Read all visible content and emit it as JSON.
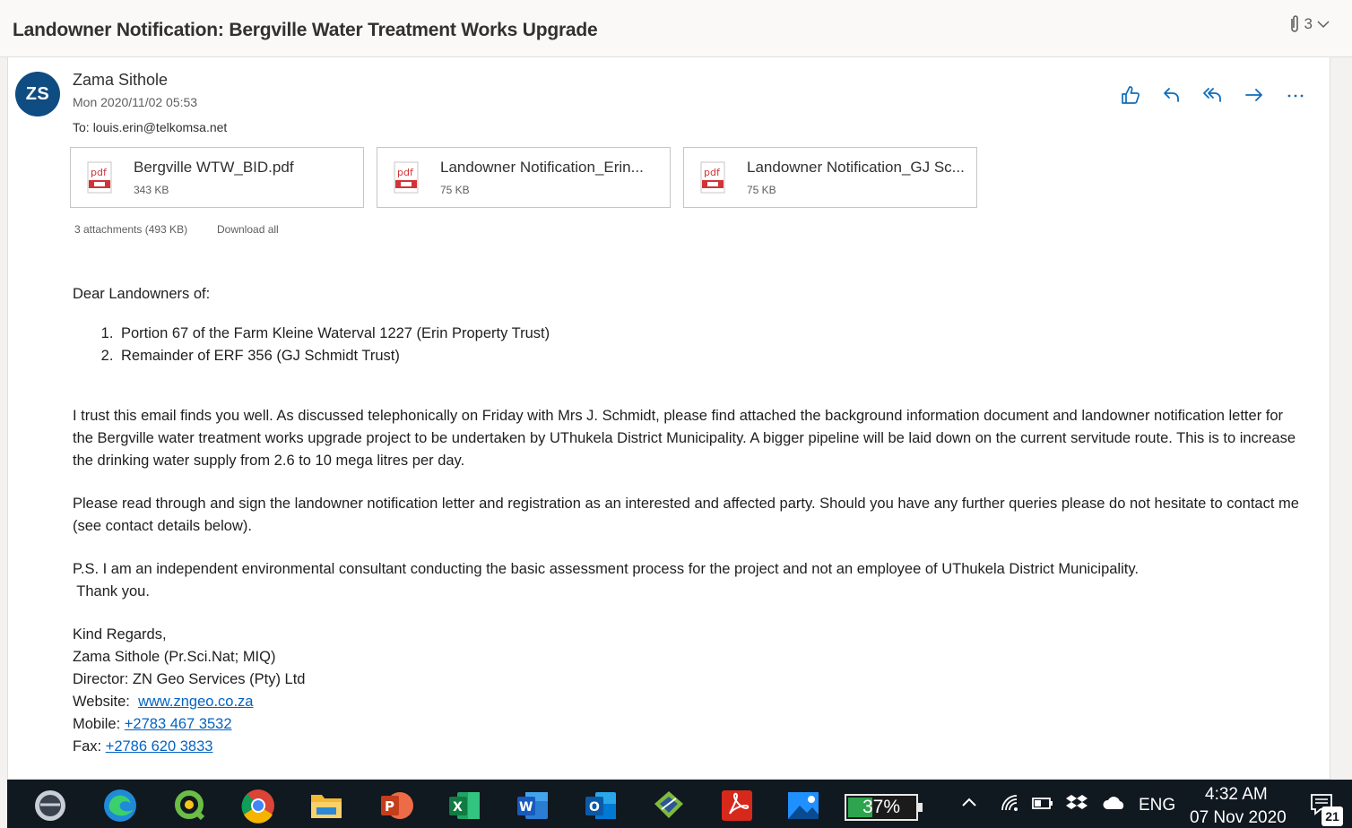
{
  "subject": "Landowner Notification: Bergville Water Treatment Works Upgrade",
  "message_count": "3",
  "sender": {
    "initials": "ZS",
    "name": "Zama Sithole",
    "date": "Mon 2020/11/02 05:53",
    "to_label": "To:",
    "to": "louis.erin@telkomsa.net"
  },
  "attachments": [
    {
      "name": "Bergville WTW_BID.pdf",
      "size": "343 KB",
      "type_label": "pdf"
    },
    {
      "name": "Landowner Notification_Erin...",
      "size": "75 KB",
      "type_label": "pdf"
    },
    {
      "name": "Landowner Notification_GJ Sc...",
      "size": "75 KB",
      "type_label": "pdf"
    }
  ],
  "attachment_summary": "3 attachments (493 KB)",
  "download_all": "Download all",
  "body": {
    "greeting": "Dear Landowners of:",
    "list": [
      "Portion 67 of the Farm Kleine Waterval 1227 (Erin Property Trust)",
      "Remainder of ERF 356 (GJ Schmidt Trust)"
    ],
    "para1": "I trust this email finds you well. As discussed telephonically on Friday with Mrs J. Schmidt, please find attached the background information document and landowner notification letter for the Bergville water treatment works upgrade project to be undertaken by UThukela District Municipality. A bigger pipeline will be laid down on the current servitude route. This is to increase the drinking water supply from 2.6 to 10 mega litres per day.",
    "para2": "Please read through and sign the landowner notification letter and registration as an interested and affected party. Should you have any further queries please do not hesitate to contact me (see contact details below).",
    "para3a": "P.S. I am an independent environmental consultant conducting the basic assessment process for the project and not an employee of UThukela District Municipality.",
    "para3b": " Thank you.",
    "signoff": "Kind Regards,",
    "sig_name": "Zama Sithole (Pr.Sci.Nat; MIQ)",
    "sig_title": "Director: ZN Geo Services (Pty) Ltd",
    "website_label": "Website: ",
    "website": "www.zngeo.co.za",
    "mobile_label": "Mobile: ",
    "mobile": "+2783 467 3532",
    "fax_label": "Fax: ",
    "fax": "+2786 620 3833"
  },
  "taskbar": {
    "battery_percent": "37%",
    "battery_level": 0.37,
    "language": "ENG",
    "time": "4:32 AM",
    "date": "07 Nov 2020",
    "notification_count": "21",
    "apps": [
      "steam-icon",
      "edge-icon",
      "qlik-icon",
      "chrome-icon",
      "file-explorer-icon",
      "powerpoint-icon",
      "excel-icon",
      "word-icon",
      "outlook-icon",
      "app-icon",
      "acrobat-icon",
      "photos-icon"
    ]
  },
  "colors": {
    "avatar": "#0f4c81",
    "link": "#0563c1",
    "action_icons": "#0f6cbd",
    "taskbar": "#101820"
  }
}
